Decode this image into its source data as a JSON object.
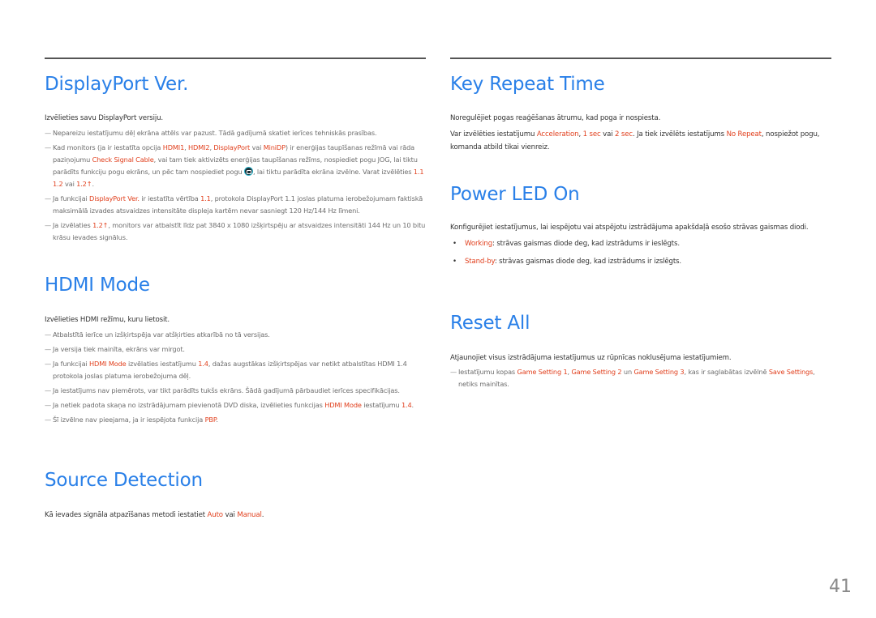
{
  "page_number": "41",
  "left_column": {
    "displayport": {
      "title": "DisplayPort Ver.",
      "lead": "Izvēlieties savu DisplayPort versiju.",
      "note1": "Nepareizu iestatījumu dēļ ekrāna attēls var pazust. Tādā gadījumā skatiet ierīces tehniskās prasības.",
      "note2": {
        "t1": "Kad monitors (ja ir iestatīta opcija ",
        "h1": "HDMI1",
        "t2": ", ",
        "h2": "HDMI2",
        "t3": ", ",
        "h3": "DisplayPort",
        "t4": " vai ",
        "h4": "MiniDP",
        "t5": ") ir enerģijas taupīšanas režīmā vai rāda paziņojumu ",
        "h5": "Check Signal Cable",
        "t6": ", vai tam tiek aktivizēts enerģijas taupīšanas režīms, nospiediet pogu JOG, lai tiktu parādīts funkciju pogu ekrāns, un pēc tam nospiediet pogu ",
        "icon": "jog-menu-icon",
        "t7": ", lai tiktu parādīta ekrāna izvēlne. Varat izvēlēties ",
        "h6": "1.1",
        "t8": " ",
        "h7": "1.2",
        "t9": " vai ",
        "h8": "1.2↑",
        "t10": "."
      },
      "note3": {
        "t1": "Ja funkcijai ",
        "h1": "DisplayPort Ver.",
        "t2": " ir iestatīta vērtība ",
        "h2": "1.1",
        "t3": ", protokola DisplayPort 1.1 joslas platuma ierobežojumam faktiskā maksimālā izvades atsvaidzes intensitāte displeja kartēm nevar sasniegt 120 Hz/144 Hz līmeni."
      },
      "note4": {
        "t1": "Ja izvēlaties ",
        "h1": "1.2↑",
        "t2": ", monitors var atbalstīt līdz pat 3840 x 1080 izšķirtspēju ar atsvaidzes intensitāti 144 Hz un 10 bitu krāsu ievades signālus."
      }
    },
    "hdmi": {
      "title": "HDMI Mode",
      "lead": "Izvēlieties HDMI režīmu, kuru lietosit.",
      "note1": "Atbalstītā ierīce un izšķirtspēja var atšķirties atkarībā no tā versijas.",
      "note2": "Ja versija tiek mainīta, ekrāns var mirgot.",
      "note3": {
        "t1": "Ja funkcijai ",
        "h1": "HDMI Mode",
        "t2": " izvēlaties iestatījumu ",
        "h2": "1.4",
        "t3": ", dažas augstākas izšķirtspējas var netikt atbalstītas HDMI 1.4 protokola joslas platuma ierobežojuma dēļ."
      },
      "note4": "Ja iestatījums nav piemērots, var tikt parādīts tukšs ekrāns. Šādā gadījumā pārbaudiet ierīces specifikācijas.",
      "note5": {
        "t1": "Ja netiek padota skaņa no izstrādājumam pievienotā DVD diska, izvēlieties funkcijas ",
        "h1": "HDMI Mode",
        "t2": " iestatījumu ",
        "h2": "1.4",
        "t3": "."
      },
      "note6": {
        "t1": "Šī izvēlne nav pieejama, ja ir iespējota funkcija ",
        "h1": "PBP",
        "t2": "."
      }
    },
    "source": {
      "title": "Source Detection",
      "lead": {
        "t1": "Kā ievades signāla atpazīšanas metodi iestatiet ",
        "h1": "Auto",
        "t2": " vai ",
        "h2": "Manual",
        "t3": "."
      }
    }
  },
  "right_column": {
    "key_repeat": {
      "title": "Key Repeat Time",
      "lead": "Noregulējiet pogas reaģēšanas ātrumu, kad poga ir nospiesta.",
      "para": {
        "t1": "Var izvēlēties iestatījumu ",
        "h1": "Acceleration",
        "t2": ", ",
        "h2": "1 sec",
        "t3": " vai ",
        "h3": "2 sec",
        "t4": ". Ja tiek izvēlēts iestatījums ",
        "h4": "No Repeat",
        "t5": ", nospiežot pogu, komanda atbild tikai vienreiz."
      }
    },
    "power_led": {
      "title": "Power LED On",
      "lead": "Konfigurējiet iestatījumus, lai iespējotu vai atspējotu izstrādājuma apakšdaļā esošo strāvas gaismas diodi.",
      "bullets": [
        {
          "label": "Working",
          "text": ": strāvas gaismas diode deg, kad izstrādums ir ieslēgts."
        },
        {
          "label": "Stand-by",
          "text": ": strāvas gaismas diode deg, kad izstrādums ir izslēgts."
        }
      ]
    },
    "reset": {
      "title": "Reset All",
      "lead": "Atjaunojiet visus izstrādājuma iestatījumus uz rūpnīcas noklusējuma iestatījumiem.",
      "note1": {
        "t1": "Iestatījumu kopas ",
        "h1": "Game Setting 1",
        "t2": ", ",
        "h2": "Game Setting 2",
        "t3": " un ",
        "h3": "Game Setting 3",
        "t4": ", kas ir saglabātas izvēlnē ",
        "h4": "Save Settings",
        "t5": ", netiks mainītas."
      }
    }
  },
  "note_dash": "—",
  "bullet_dot": "•"
}
